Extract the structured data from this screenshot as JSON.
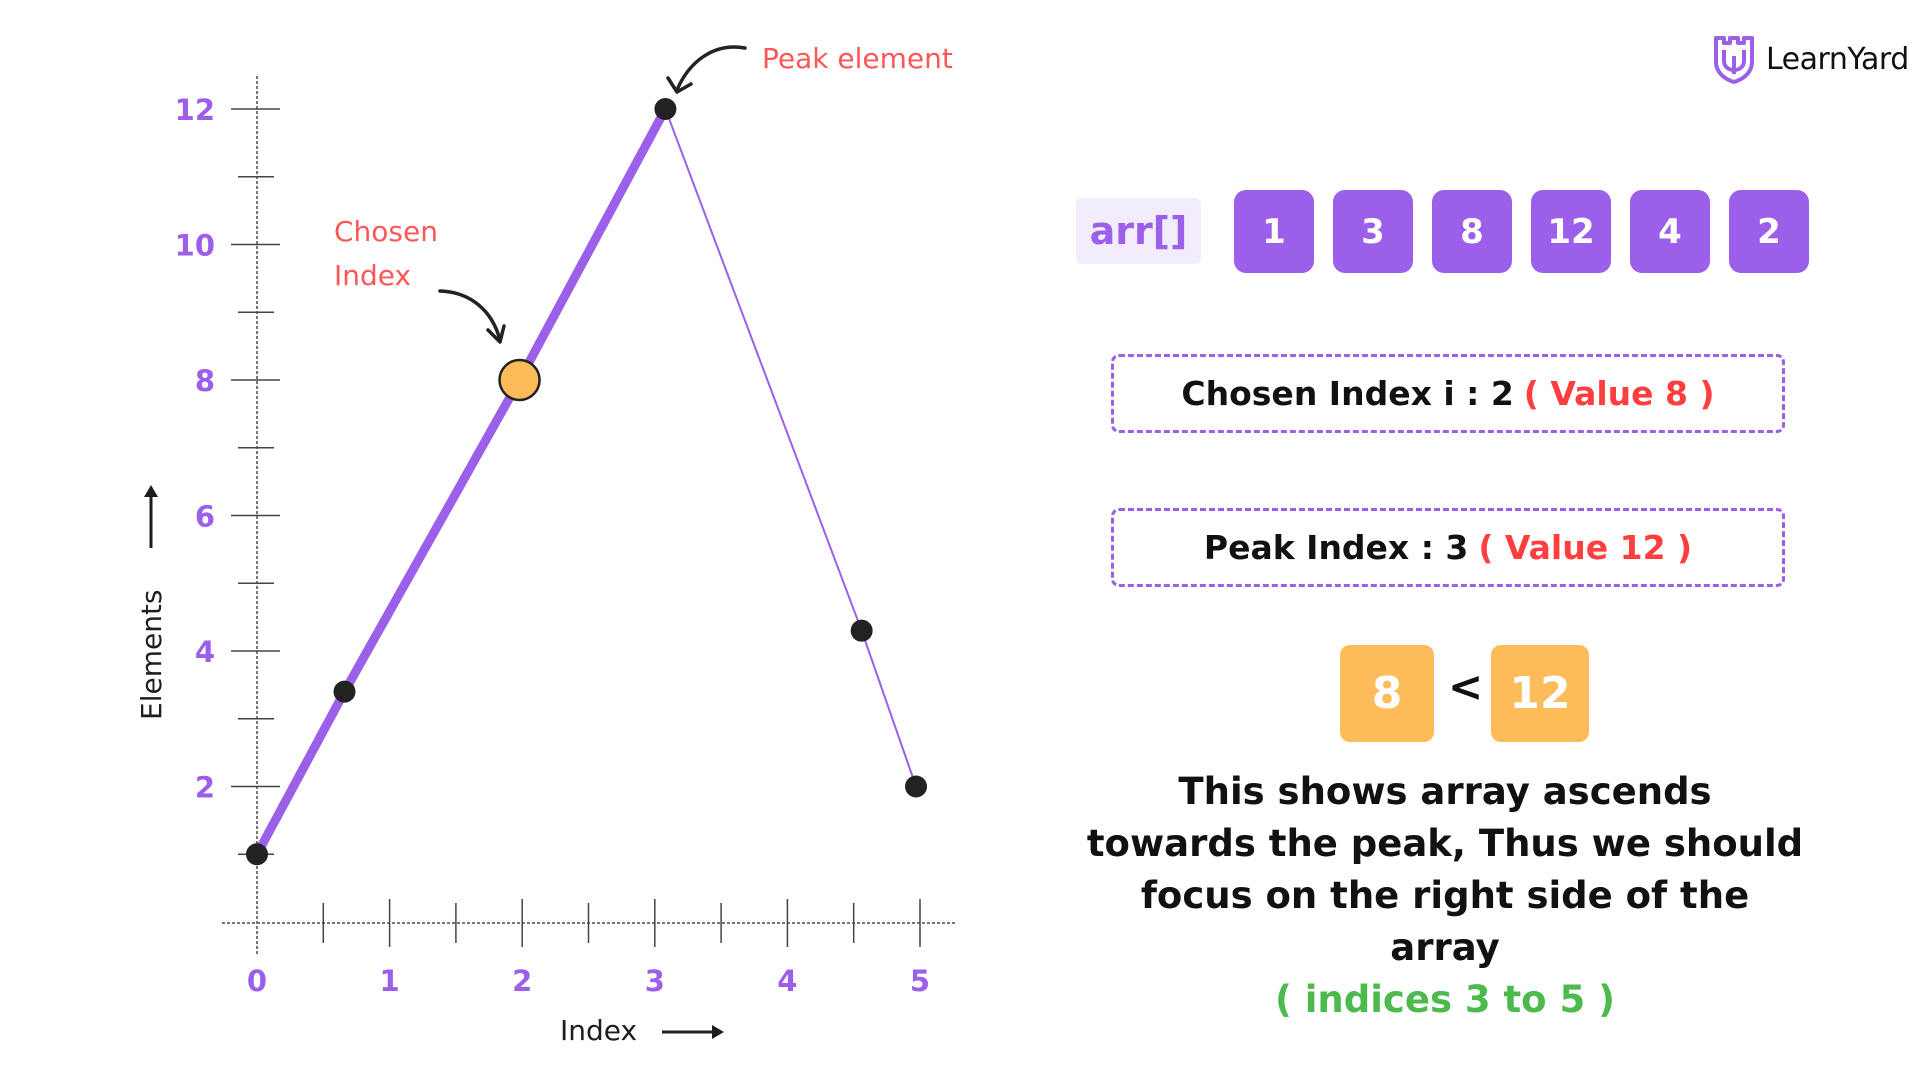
{
  "brand": {
    "name": "LearnYard",
    "icon": "learnyard-shield-logo",
    "color": "#9b5fea"
  },
  "colors": {
    "accent": "#9b5fea",
    "annotation": "#ff5757",
    "highlight": "#fdbb5a",
    "success": "#4cba4c",
    "point": "#222222"
  },
  "array": {
    "label": "arr[]",
    "values": [
      "1",
      "3",
      "8",
      "12",
      "4",
      "2"
    ]
  },
  "info": {
    "chosen": {
      "label": "Chosen Index i : 2",
      "value": "( Value 8 )"
    },
    "peak": {
      "label": "Peak Index : 3",
      "value": "( Value 12 )"
    }
  },
  "comparison": {
    "left": "8",
    "operator": "<",
    "right": "12"
  },
  "explanation": {
    "lines": [
      "This shows array ascends",
      "towards the peak, Thus we should",
      "focus on the right side of the array"
    ],
    "highlight": "( indices 3 to 5 )"
  },
  "chart_data": {
    "type": "line",
    "title": "",
    "xlabel": "Index",
    "ylabel": "Elements",
    "x_ticks": [
      "0",
      "1",
      "2",
      "3",
      "4",
      "5"
    ],
    "y_ticks": [
      "2",
      "4",
      "6",
      "8",
      "10",
      "12"
    ],
    "xlim": [
      0,
      5
    ],
    "ylim": [
      0,
      12
    ],
    "grid": false,
    "series": [
      {
        "name": "arr",
        "x": [
          0,
          0.66,
          1.98,
          3.08,
          4.56,
          4.97
        ],
        "values": [
          1,
          3.4,
          8,
          12,
          4.3,
          2
        ],
        "array_values": [
          1,
          3,
          8,
          12,
          4,
          2
        ]
      }
    ],
    "highlighted_ascending_segment": [
      0,
      3
    ],
    "chosen_point_index": 2,
    "peak_point_index": 3,
    "annotations": [
      {
        "text": "Peak element",
        "target_index": 3
      },
      {
        "text": "Chosen",
        "text2": "Index",
        "target_index": 2
      }
    ]
  }
}
